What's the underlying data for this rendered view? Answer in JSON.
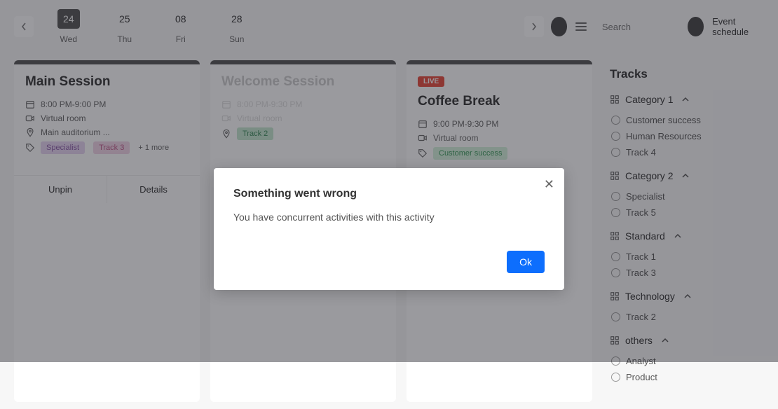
{
  "header": {
    "dates": [
      {
        "num": "24",
        "day": "Wed",
        "active": true
      },
      {
        "num": "25",
        "day": "Thu",
        "active": false
      },
      {
        "num": "08",
        "day": "Fri",
        "active": false
      },
      {
        "num": "28",
        "day": "Sun",
        "active": false
      }
    ],
    "search_placeholder": "Search",
    "schedule_link": "Event schedule"
  },
  "cards": [
    {
      "title": "Main Session",
      "faded": false,
      "live": false,
      "time": "8:00 PM-9:00 PM",
      "room": "Virtual room",
      "location": "Main auditorium ...",
      "tags": [
        {
          "label": "Specialist",
          "cls": "tag-purple"
        },
        {
          "label": "Track 3",
          "cls": "tag-pink"
        }
      ],
      "more": "+ 1 more",
      "btn1": "Unpin",
      "btn2": "Details"
    },
    {
      "title": "Welcome Session",
      "faded": true,
      "live": false,
      "time": "8:00 PM-9:30 PM",
      "room": "Virtual room",
      "location": "Track 2",
      "location_cls": "tag-teal"
    },
    {
      "title": "Coffee Break",
      "faded": false,
      "live": true,
      "live_text": "LIVE",
      "time": "9:00 PM-9:30 PM",
      "room": "Virtual room",
      "tags": [
        {
          "label": "Customer success",
          "cls": "tag-green"
        }
      ]
    }
  ],
  "sidebar": {
    "title": "Tracks",
    "groups": [
      {
        "name": "Category 1",
        "items": [
          "Customer success",
          "Human Resources",
          "Track 4"
        ]
      },
      {
        "name": "Category 2",
        "items": [
          "Specialist",
          "Track 5"
        ]
      },
      {
        "name": "Standard",
        "items": [
          "Track 1",
          "Track 3"
        ]
      },
      {
        "name": "Technology",
        "items": [
          "Track 2"
        ]
      },
      {
        "name": "others",
        "items": [
          "Analyst",
          "Product"
        ]
      }
    ]
  },
  "modal": {
    "title": "Something went wrong",
    "text": "You have concurrent activities with this activity",
    "ok": "Ok"
  }
}
